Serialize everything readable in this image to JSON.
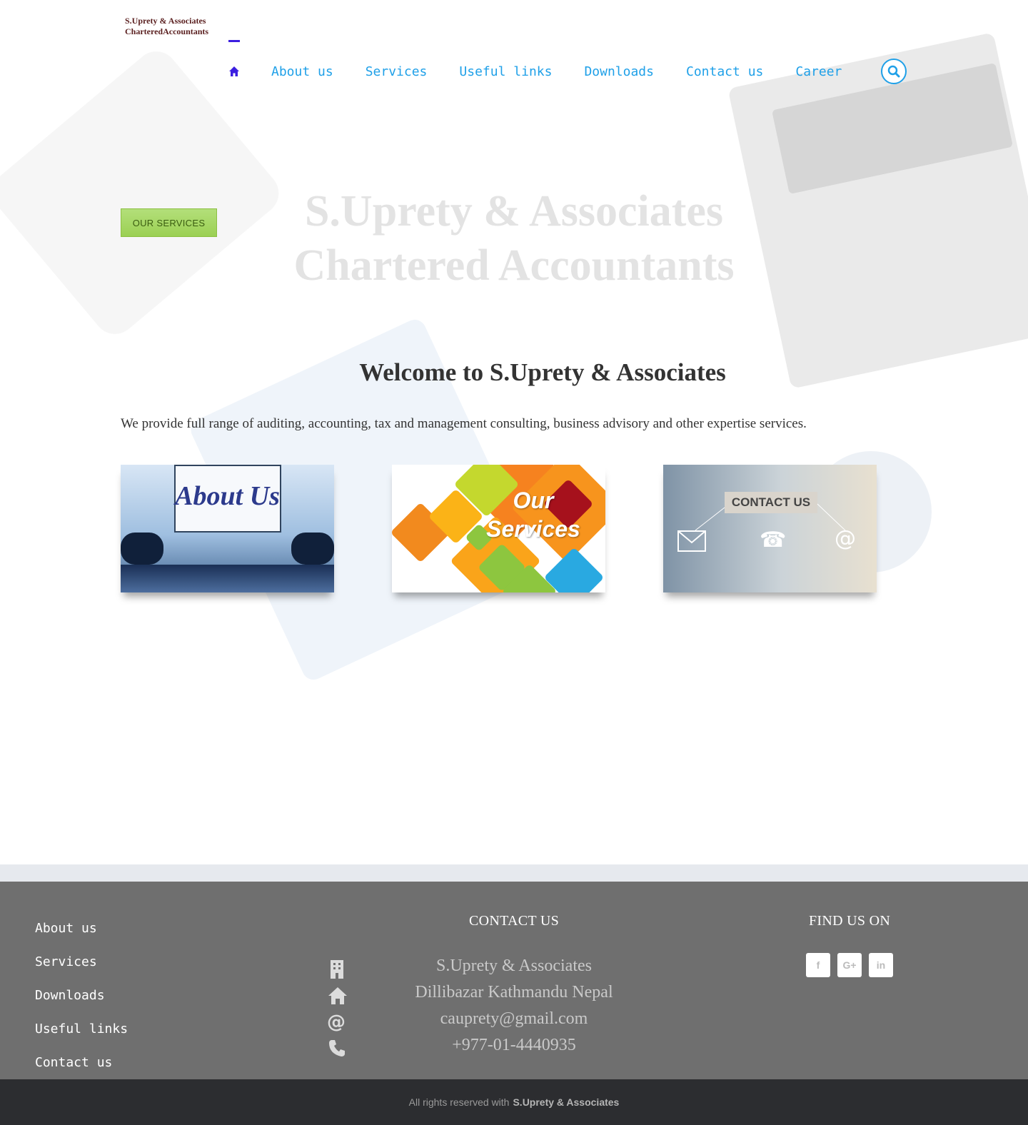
{
  "logo": {
    "line1": "S.Uprety & Associates",
    "line2": "CharteredAccountants"
  },
  "nav": {
    "home_icon": "home-icon",
    "items": [
      "About us",
      "Services",
      "Useful links",
      "Downloads",
      "Contact us",
      "Career"
    ],
    "search_icon": "search-icon",
    "accent": "#1fa0e8",
    "active_color": "#3b1ee0"
  },
  "hero": {
    "button_label": "OUR SERVICES",
    "title_line1": "S.Uprety & Associates",
    "title_line2": "Chartered Accountants"
  },
  "welcome": {
    "heading": "Welcome to S.Uprety & Associates",
    "intro": "We provide full range of auditing, accounting, tax and management consulting, business advisory and other expertise services."
  },
  "cards": {
    "about": {
      "text": "About Us"
    },
    "services": {
      "line1": "Our",
      "line2": "Services"
    },
    "contact": {
      "text": "CONTACT US",
      "icons": [
        "envelope-icon",
        "telephone-icon",
        "at-icon"
      ]
    }
  },
  "footer": {
    "links": [
      "About us",
      "Services",
      "Downloads",
      "Useful links",
      "Contact us"
    ],
    "contact_heading": "CONTACT US",
    "contact_icons": [
      "building-icon",
      "home-icon",
      "at-icon",
      "phone-icon"
    ],
    "contact_lines": [
      "S.Uprety & Associates",
      "Dillibazar Kathmandu Nepal",
      "cauprety@gmail.com",
      "+977-01-4440935"
    ],
    "find_heading": "FIND US ON",
    "socials": [
      {
        "icon": "facebook-icon",
        "label": "f"
      },
      {
        "icon": "google-plus-icon",
        "label": "G+"
      },
      {
        "icon": "linkedin-icon",
        "label": "in"
      }
    ],
    "copyright_prefix": "All rights reserved with",
    "copyright_name": "S.Uprety & Associates"
  }
}
